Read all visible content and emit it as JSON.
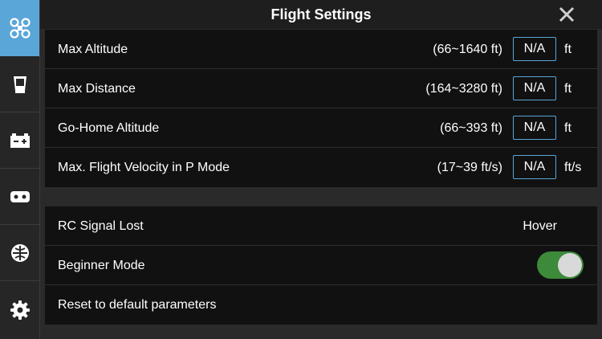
{
  "header": {
    "title": "Flight Settings"
  },
  "sidebar": {
    "items": [
      {
        "icon": "aircraft-icon",
        "active": true
      },
      {
        "icon": "gimbal-icon",
        "active": false
      },
      {
        "icon": "battery-icon",
        "active": false
      },
      {
        "icon": "remote-controller-icon",
        "active": false
      },
      {
        "icon": "video-transmission-icon",
        "active": false
      },
      {
        "icon": "gear-icon",
        "active": false
      }
    ]
  },
  "limits": [
    {
      "label": "Max Altitude",
      "range": "(66~1640 ft)",
      "value": "N/A",
      "unit": "ft"
    },
    {
      "label": "Max Distance",
      "range": "(164~3280 ft)",
      "value": "N/A",
      "unit": "ft"
    },
    {
      "label": "Go-Home Altitude",
      "range": "(66~393 ft)",
      "value": "N/A",
      "unit": "ft"
    },
    {
      "label": "Max. Flight Velocity in P Mode",
      "range": "(17~39 ft/s)",
      "value": "N/A",
      "unit": "ft/s"
    }
  ],
  "options": {
    "rc_signal_lost": {
      "label": "RC Signal Lost",
      "value": "Hover"
    },
    "beginner_mode": {
      "label": "Beginner Mode",
      "enabled": true
    },
    "reset": {
      "label": "Reset to default parameters"
    }
  },
  "colors": {
    "accent": "#5aa6d8",
    "toggle_on": "#3c8a3a"
  }
}
